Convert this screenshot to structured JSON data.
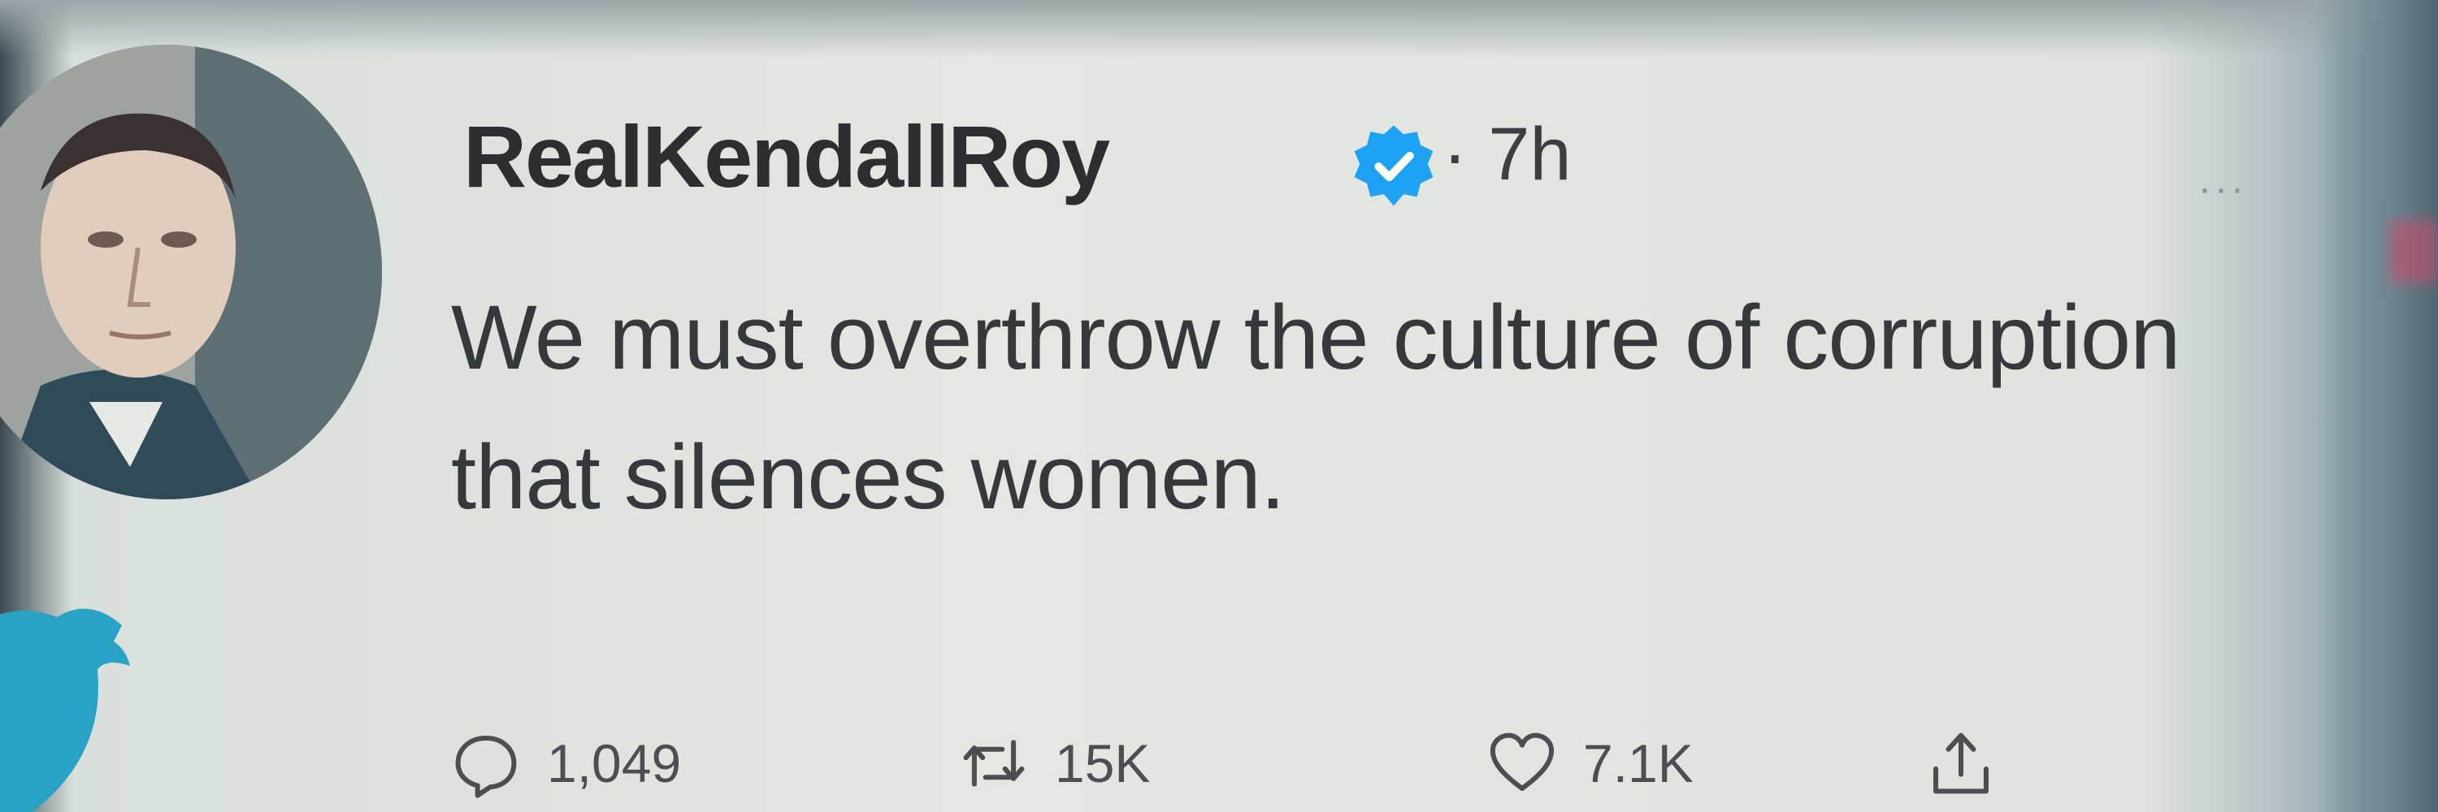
{
  "tweet": {
    "username": "RealKendallRoy",
    "timestamp": "· 7h",
    "more": "···",
    "text": "We must overthrow the culture of corruption that silences women.",
    "reply_count": "1,049",
    "retweet_count": "15K",
    "like_count": "7.1K"
  },
  "colors": {
    "verified": "#1da1f2",
    "bird": "#29a3c4"
  },
  "icons": {
    "verified": "verified-badge-icon",
    "reply": "reply-icon",
    "retweet": "retweet-icon",
    "like": "heart-icon",
    "share": "share-icon",
    "bird": "twitter-bird-icon",
    "more": "more-options-icon"
  }
}
